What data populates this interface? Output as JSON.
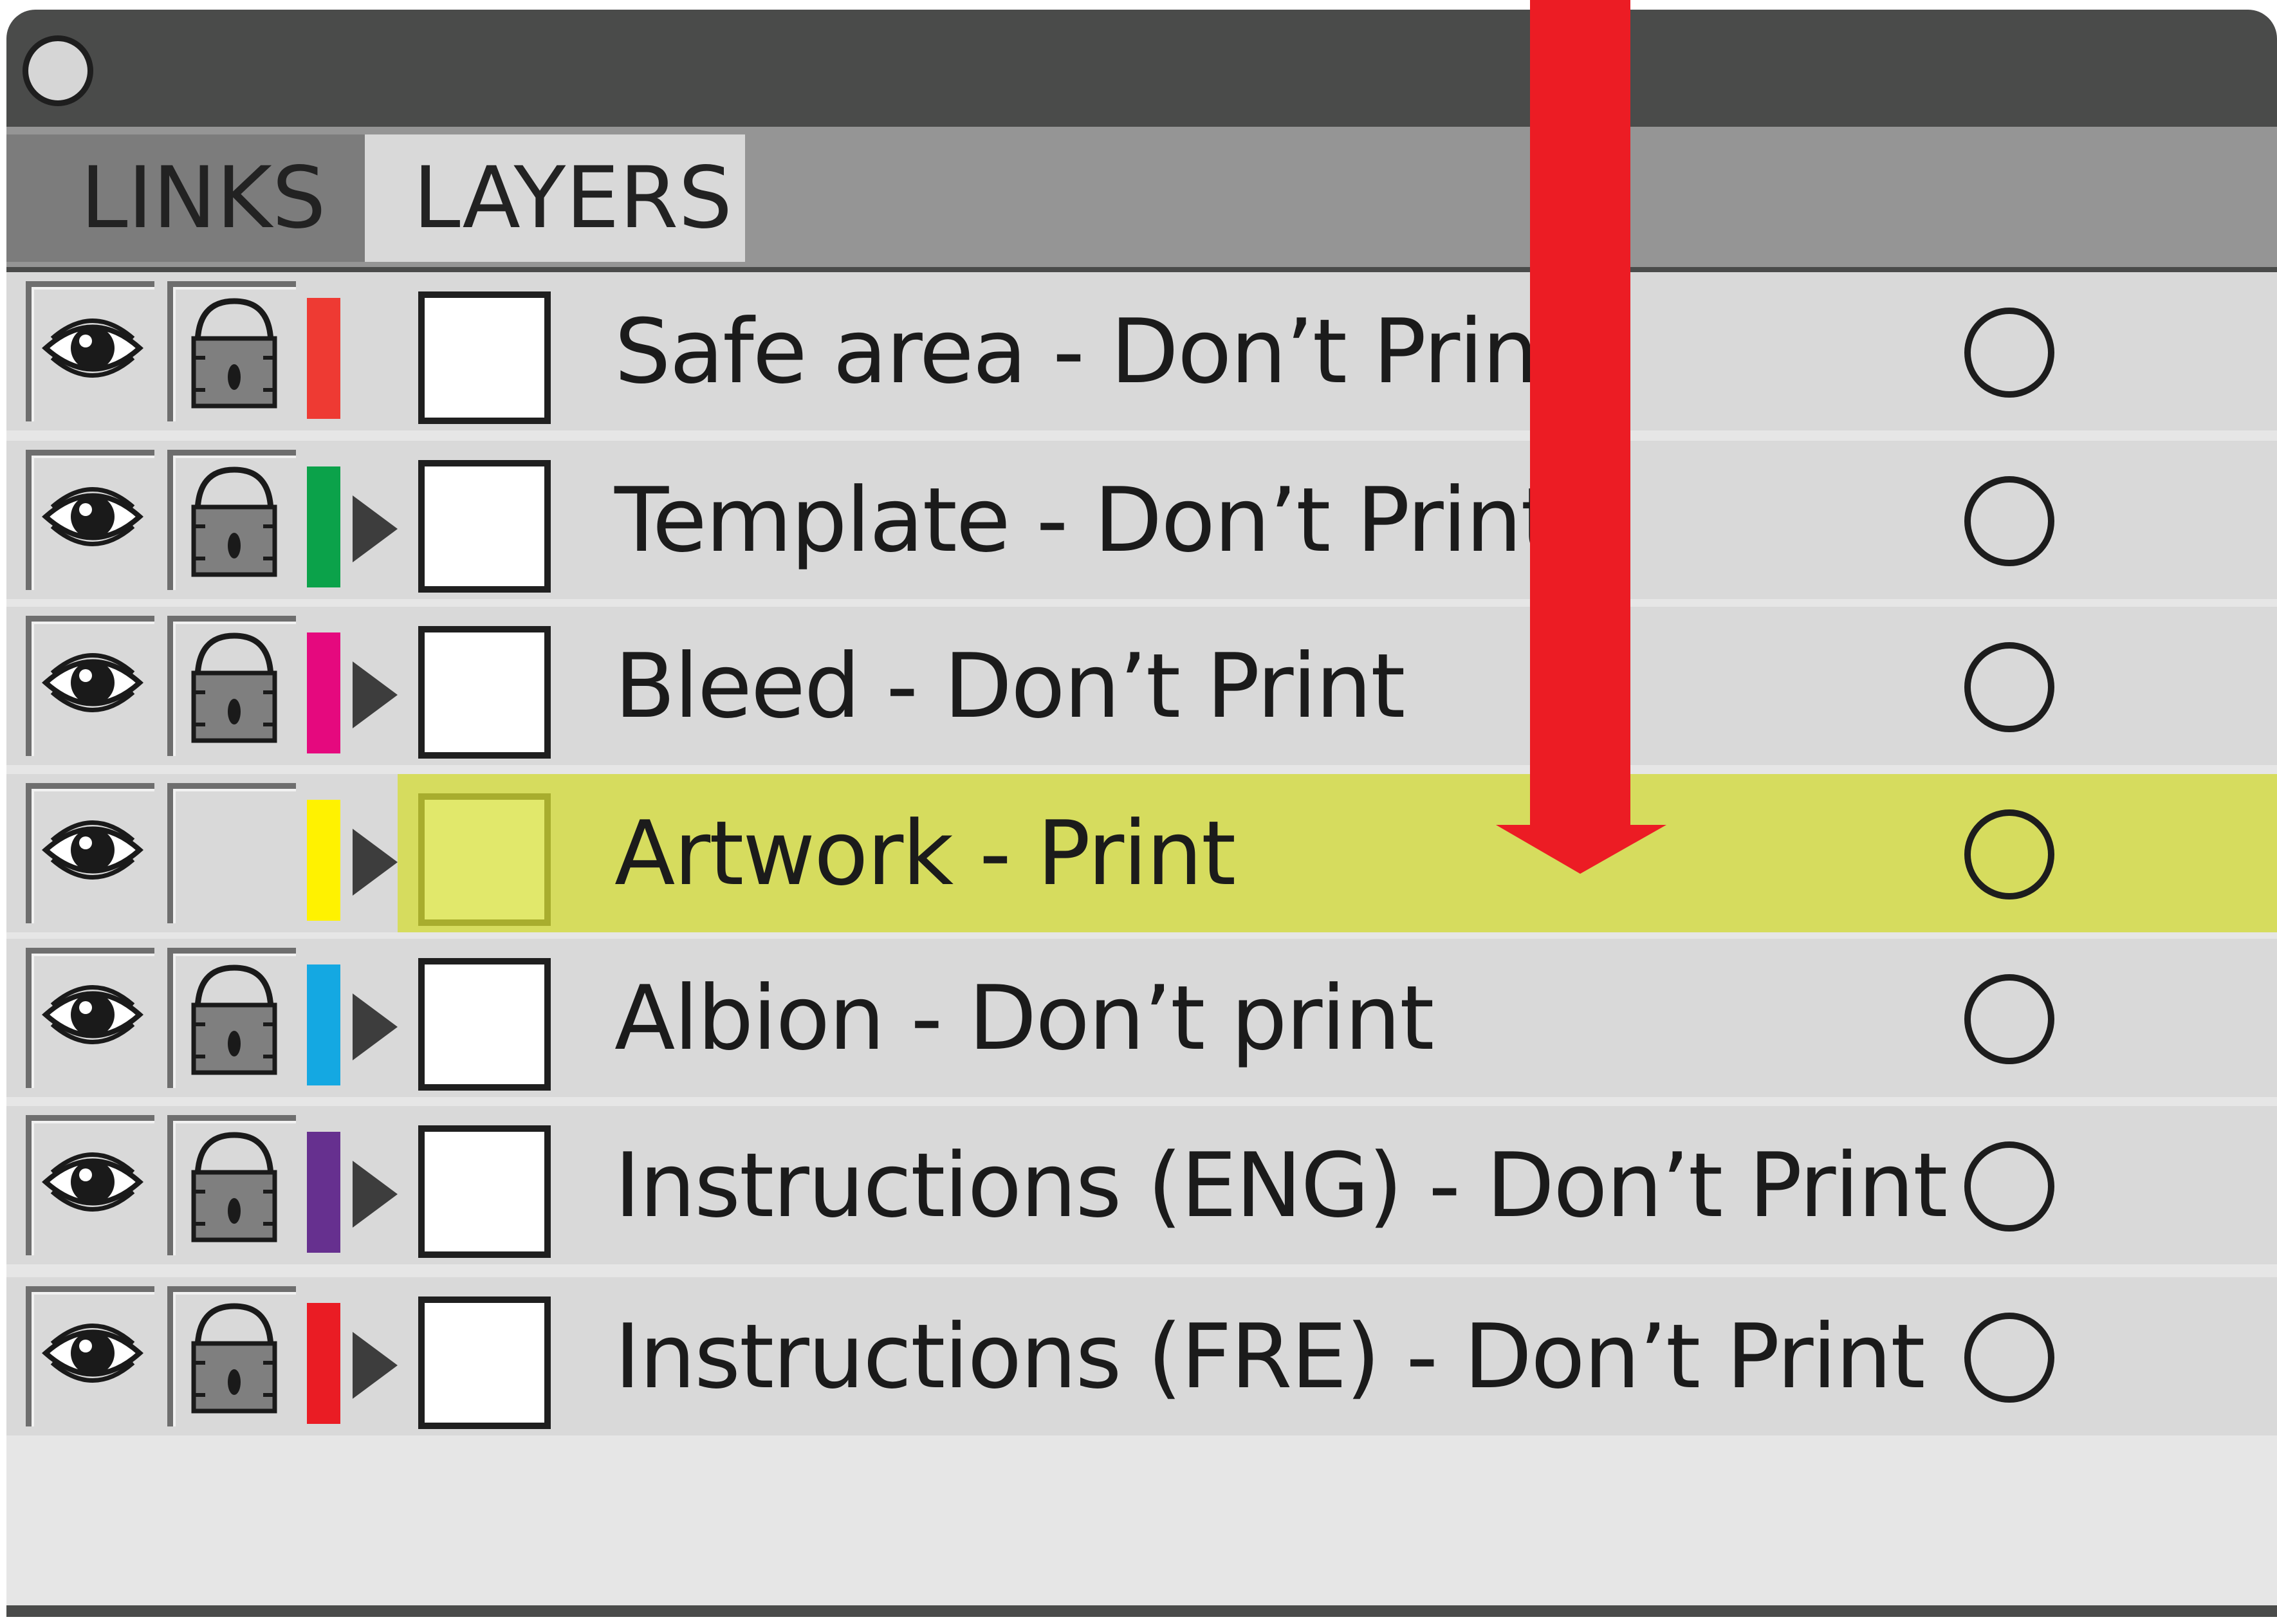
{
  "tabs": [
    {
      "label": "LINKS",
      "active": false
    },
    {
      "label": "LAYERS",
      "active": true
    }
  ],
  "layers": [
    {
      "name": "Safe area - Don’t Print",
      "color": "#ee3a33",
      "visible": true,
      "locked": true,
      "expandable": false,
      "selected": false
    },
    {
      "name": "Template - Don’t Print",
      "color": "#0ba24a",
      "visible": true,
      "locked": true,
      "expandable": true,
      "selected": false
    },
    {
      "name": "Bleed - Don’t Print",
      "color": "#e5097e",
      "visible": true,
      "locked": true,
      "expandable": true,
      "selected": false
    },
    {
      "name": "Artwork - Print",
      "color": "#fff200",
      "visible": true,
      "locked": false,
      "expandable": true,
      "selected": true
    },
    {
      "name": "Albion - Don’t print",
      "color": "#14a8e2",
      "visible": true,
      "locked": true,
      "expandable": true,
      "selected": false
    },
    {
      "name": "Instructions (ENG) - Don’t Print",
      "color": "#66308f",
      "visible": true,
      "locked": true,
      "expandable": true,
      "selected": false
    },
    {
      "name": "Instructions (FRE) - Don’t Print",
      "color": "#ea1c24",
      "visible": true,
      "locked": true,
      "expandable": true,
      "selected": false
    }
  ],
  "icons": {
    "close": "close-circle-icon",
    "visibility": "eye-icon",
    "lock": "padlock-icon",
    "expand": "triangle-right-icon",
    "target": "target-circle-icon",
    "annotation": "down-arrow-icon"
  },
  "colors": {
    "panel_dark": "#4a4b4a",
    "tab_bar": "#959595",
    "row_bg": "#d9d9d9",
    "selection": "#d6dc5e",
    "annotation_arrow": "#ec1c24"
  }
}
